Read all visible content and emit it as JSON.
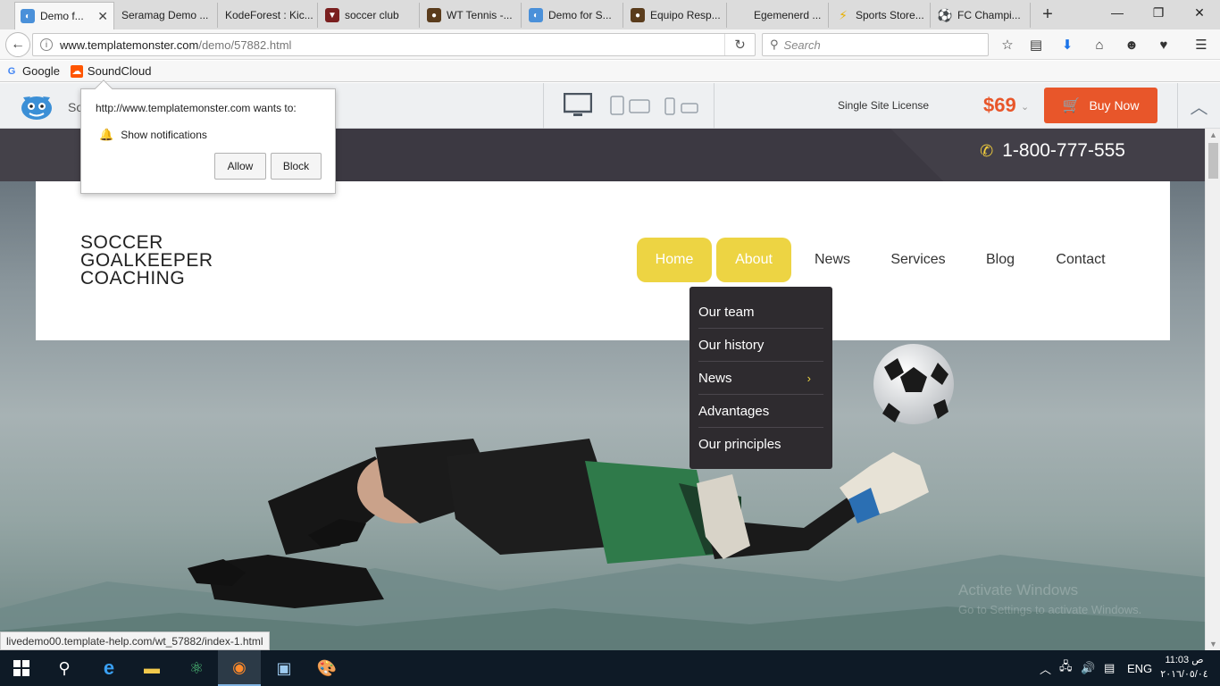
{
  "browser": {
    "tabs": [
      {
        "label": "Demo f...",
        "icon": "templatemonster-icon",
        "active": true
      },
      {
        "label": "Seramag Demo ...",
        "icon": "blank-icon",
        "active": false
      },
      {
        "label": "KodeForest : Kic...",
        "icon": "blank-icon",
        "active": false
      },
      {
        "label": "soccer club",
        "icon": "shield-icon",
        "active": false
      },
      {
        "label": "WT Tennis -...",
        "icon": "tennis-icon",
        "active": false
      },
      {
        "label": "Demo for S...",
        "icon": "templatemonster-icon",
        "active": false
      },
      {
        "label": "Equipo Resp...",
        "icon": "team-icon",
        "active": false
      },
      {
        "label": "Egemenerd ...",
        "icon": "blank-icon",
        "active": false
      },
      {
        "label": "Sports Store...",
        "icon": "lightning-icon",
        "active": false
      },
      {
        "label": "FC Champi...",
        "icon": "soccer-ball-icon",
        "active": false
      }
    ],
    "url_domain": "www.templatemonster.com",
    "url_path": "/demo/57882.html",
    "search_placeholder": "Search",
    "bookmarks": [
      {
        "label": "Google",
        "icon": "google-icon"
      },
      {
        "label": "SoundCloud",
        "icon": "soundcloud-icon"
      }
    ],
    "status_url": "livedemo00.template-help.com/wt_57882/index-1.html"
  },
  "tm_bar": {
    "label": "So",
    "license": "Single Site License",
    "price": "$69",
    "buy_label": "Buy Now"
  },
  "notification": {
    "title": "http://www.templatemonster.com wants to:",
    "permission": "Show notifications",
    "allow_label": "Allow",
    "block_label": "Block"
  },
  "site": {
    "phone": "1-800-777-555",
    "logo_lines": [
      "SOCCER",
      "GOALKEEPER",
      "COACHING"
    ],
    "menu": [
      {
        "label": "Home",
        "active": true
      },
      {
        "label": "About",
        "active": true
      },
      {
        "label": "News",
        "active": false
      },
      {
        "label": "Services",
        "active": false
      },
      {
        "label": "Blog",
        "active": false
      },
      {
        "label": "Contact",
        "active": false
      }
    ],
    "dropdown": [
      {
        "label": "Our team",
        "submenu": false
      },
      {
        "label": "Our history",
        "submenu": false
      },
      {
        "label": "News",
        "submenu": true
      },
      {
        "label": "Advantages",
        "submenu": false
      },
      {
        "label": "Our principles",
        "submenu": false
      }
    ],
    "watermark": [
      "Activate Windows",
      "Go to Settings to activate Windows."
    ]
  },
  "taskbar": {
    "language": "ENG",
    "time": "11:03 ص",
    "date": "٢٠١٦/٠٥/٠٤"
  },
  "colors": {
    "accent_yellow": "#edd443",
    "price_orange": "#e8562a",
    "header_dark": "#3c3942",
    "dropdown_bg": "#2e2b2f"
  }
}
